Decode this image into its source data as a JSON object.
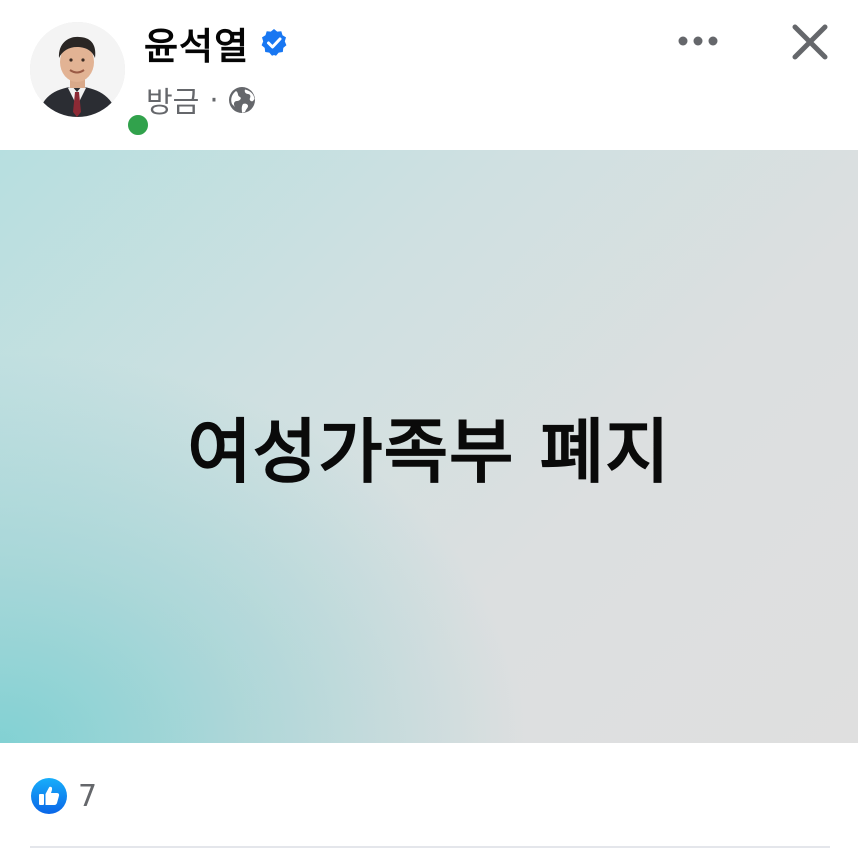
{
  "post": {
    "author_name": "윤석열",
    "time": "방금",
    "separator": "·",
    "verified": true,
    "privacy_icon": "globe-icon",
    "image_text": "여성가족부 폐지",
    "reactions": {
      "like_count": "7",
      "reaction_icon": "like-icon"
    }
  },
  "header": {
    "more_icon": "more-horizontal-icon",
    "close_icon": "close-icon"
  },
  "colors": {
    "verified_blue": "#1877f2",
    "online_green": "#31a24c",
    "secondary_text": "#65676b",
    "image_teal": "#82d1d3",
    "image_gray": "#dfdfdf"
  }
}
